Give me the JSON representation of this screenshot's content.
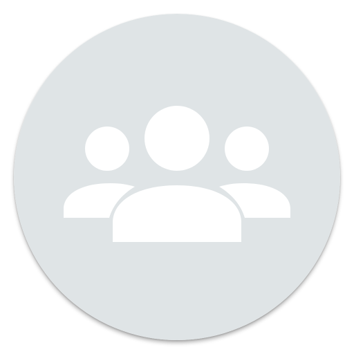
{
  "avatar": {
    "icon": "group-icon",
    "background_color": "#dfe4e6",
    "icon_color": "#ffffff"
  }
}
